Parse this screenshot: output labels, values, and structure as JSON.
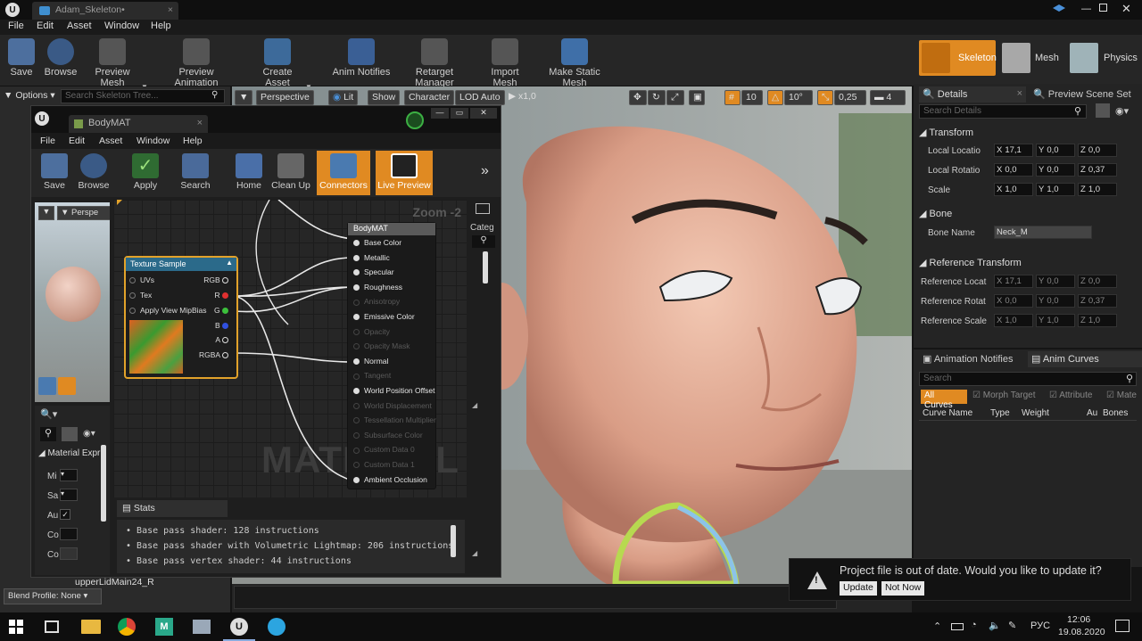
{
  "title_tab": "Adam_Skeleton•",
  "menu": [
    "File",
    "Edit",
    "Asset",
    "Window",
    "Help"
  ],
  "toolbar": [
    {
      "label": "Save",
      "icon": "save-icon"
    },
    {
      "label": "Browse",
      "icon": "browse-icon"
    },
    {
      "label": "Preview Mesh",
      "icon": "preview-mesh-icon"
    },
    {
      "label": "Preview Animation",
      "icon": "preview-animation-icon"
    },
    {
      "label": "Create Asset",
      "icon": "create-asset-icon"
    },
    {
      "label": "Anim Notifies",
      "icon": "anim-notifies-icon"
    },
    {
      "label": "Retarget Manager",
      "icon": "retarget-manager-icon"
    },
    {
      "label": "Import Mesh",
      "icon": "import-mesh-icon"
    },
    {
      "label": "Make Static Mesh",
      "icon": "make-static-mesh-icon"
    }
  ],
  "modes": {
    "skeleton": "Skeleton",
    "mesh": "Mesh",
    "physics": "Physics"
  },
  "left": {
    "options": "Options",
    "search_placeholder": "Search Skeleton Tree...",
    "bone_row": "upperLidMain24_R",
    "blend_profile": "Blend Profile: None"
  },
  "viewport": {
    "perspective": "Perspective",
    "lit": "Lit",
    "show": "Show",
    "character": "Character",
    "lod": "LOD Auto",
    "speed": "x1,0",
    "snap_grid": "10",
    "snap_rot": "10°",
    "snap_scale": "0,25",
    "cam_speed": "4"
  },
  "details": {
    "tab_details": "Details",
    "tab_preview": "Preview Scene Set",
    "search_placeholder": "Search Details",
    "transform": "Transform",
    "rows": [
      {
        "label": "Local Locatio",
        "x": "17,1",
        "y": "0,0",
        "z": "0,0"
      },
      {
        "label": "Local Rotatio",
        "x": "0,0",
        "y": "0,0",
        "z": "0,37"
      },
      {
        "label": "Scale",
        "x": "1,0",
        "y": "1,0",
        "z": "1,0"
      }
    ],
    "bone": "Bone",
    "bone_name_label": "Bone Name",
    "bone_name": "Neck_M",
    "ref_transform": "Reference Transform",
    "ref_rows": [
      {
        "label": "Reference Locat",
        "x": "17,1",
        "y": "0,0",
        "z": "0,0"
      },
      {
        "label": "Reference Rotat",
        "x": "0,0",
        "y": "0,0",
        "z": "0,37"
      },
      {
        "label": "Reference Scale",
        "x": "1,0",
        "y": "1,0",
        "z": "1,0"
      }
    ],
    "xyz": [
      "X",
      "Y",
      "Z"
    ]
  },
  "anim": {
    "tab_notifies": "Animation Notifies",
    "tab_curves": "Anim Curves",
    "search_placeholder": "Search",
    "filters": [
      "All Curves",
      "Morph Target",
      "Attribute",
      "Mate"
    ],
    "columns": [
      "Curve Name",
      "Type",
      "Weight",
      "Au",
      "Bones"
    ]
  },
  "material": {
    "title": "BodyMAT",
    "menu": [
      "File",
      "Edit",
      "Asset",
      "Window",
      "Help"
    ],
    "toolbar": [
      "Save",
      "Browse",
      "Apply",
      "Search",
      "Home",
      "Clean Up",
      "Connectors",
      "Live Preview"
    ],
    "zoom": "Zoom -2",
    "watermark": "MATERIAL",
    "categ": "Categ",
    "perspective": "Perspe",
    "texture_node": "Texture Sample",
    "tex_inputs": [
      "UVs",
      "Tex",
      "Apply View MipBias"
    ],
    "tex_outputs": [
      "RGB",
      "R",
      "G",
      "B",
      "A",
      "RGBA"
    ],
    "node_title": "BodyMAT",
    "inputs": [
      {
        "name": "Base Color",
        "on": true
      },
      {
        "name": "Metallic",
        "on": true
      },
      {
        "name": "Specular",
        "on": true
      },
      {
        "name": "Roughness",
        "on": true
      },
      {
        "name": "Anisotropy",
        "on": false
      },
      {
        "name": "Emissive Color",
        "on": true
      },
      {
        "name": "Opacity",
        "on": false
      },
      {
        "name": "Opacity Mask",
        "on": false
      },
      {
        "name": "Normal",
        "on": true
      },
      {
        "name": "Tangent",
        "on": false
      },
      {
        "name": "World Position Offset",
        "on": true
      },
      {
        "name": "World Displacement",
        "on": false
      },
      {
        "name": "Tessellation Multiplier",
        "on": false
      },
      {
        "name": "Subsurface Color",
        "on": false
      },
      {
        "name": "Custom Data 0",
        "on": false
      },
      {
        "name": "Custom Data 1",
        "on": false
      },
      {
        "name": "Ambient Occlusion",
        "on": true
      }
    ],
    "expr_panel": "Material Expr",
    "expr_rows": [
      "Mi",
      "Sa",
      "Au",
      "Co",
      "Co"
    ],
    "stats_title": "Stats",
    "stats": [
      "Base pass shader: 128 instructions",
      "Base pass shader with Volumetric Lightmap: 206 instructions",
      "Base pass vertex shader: 44 instructions"
    ]
  },
  "notification": {
    "message": "Project file is out of date. Would you like to update it?",
    "update": "Update",
    "not_now": "Not Now"
  },
  "taskbar": {
    "lang": "РУС",
    "time": "12:06",
    "date": "19.08.2020"
  }
}
